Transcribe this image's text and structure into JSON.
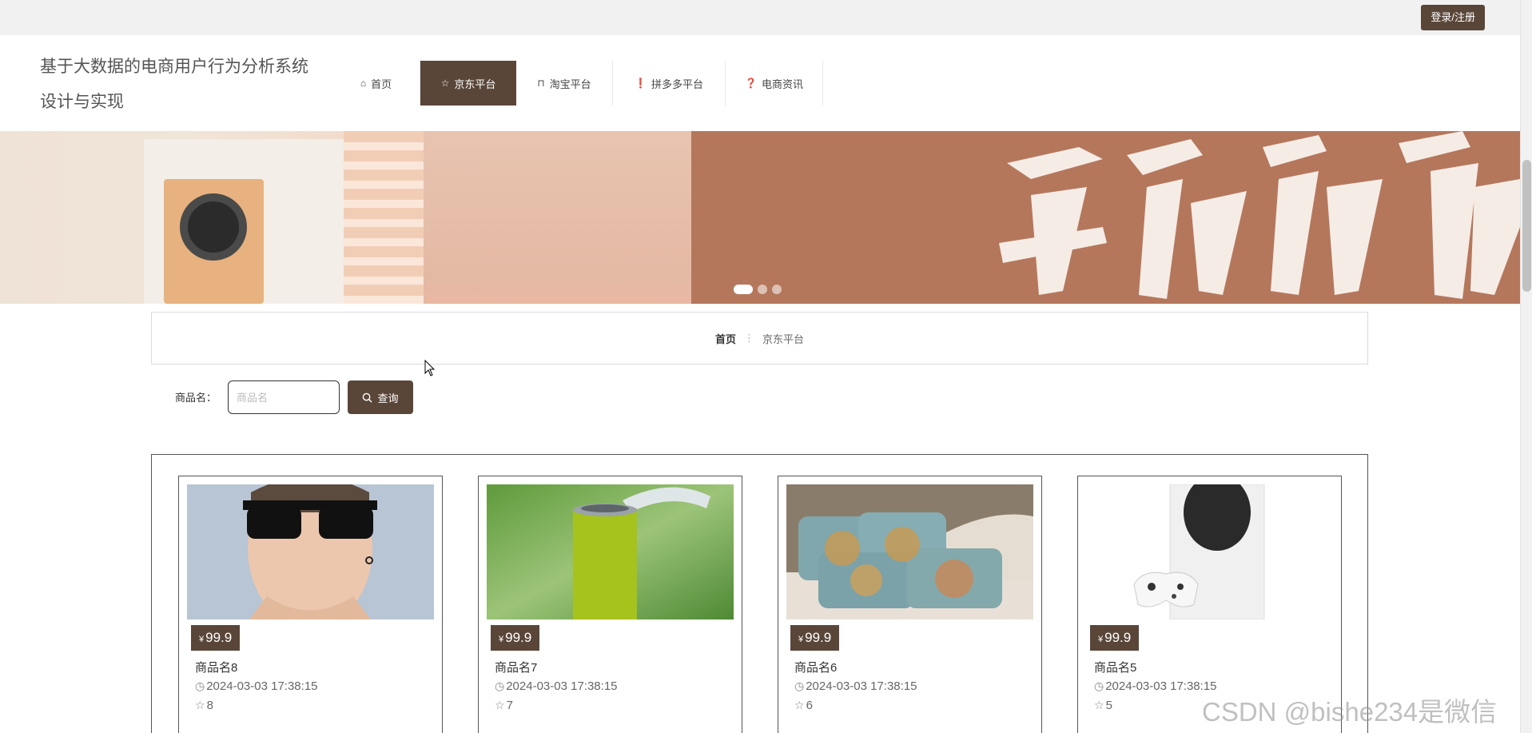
{
  "topbar": {
    "login_label": "登录/注册"
  },
  "header": {
    "title": "基于大数据的电商用户行为分析系统设计与实现",
    "nav": [
      {
        "label": "首页",
        "icon": "home-icon",
        "active": false
      },
      {
        "label": "京东平台",
        "icon": "star-icon",
        "active": true
      },
      {
        "label": "淘宝平台",
        "icon": "bag-icon",
        "active": false
      },
      {
        "label": "拼多多平台",
        "icon": "alert-icon",
        "active": false
      },
      {
        "label": "电商资讯",
        "icon": "question-icon",
        "active": false
      }
    ]
  },
  "banner": {
    "slides": 3,
    "active_slide": 1
  },
  "breadcrumb": {
    "home": "首页",
    "separator": "⋮",
    "current": "京东平台"
  },
  "search": {
    "label": "商品名：",
    "placeholder": "商品名",
    "value": "",
    "button_label": "查询"
  },
  "products": [
    {
      "price_symbol": "¥",
      "price": "99.9",
      "name": "商品名8",
      "time": "2024-03-03 17:38:15",
      "favorites": "8",
      "image": "sunglasses-man"
    },
    {
      "price_symbol": "¥",
      "price": "99.9",
      "name": "商品名7",
      "time": "2024-03-03 17:38:15",
      "favorites": "7",
      "image": "green-filter"
    },
    {
      "price_symbol": "¥",
      "price": "99.9",
      "name": "商品名6",
      "time": "2024-03-03 17:38:15",
      "favorites": "6",
      "image": "pillows"
    },
    {
      "price_symbol": "¥",
      "price": "99.9",
      "name": "商品名5",
      "time": "2024-03-03 17:38:15",
      "favorites": "5",
      "image": "game-console"
    }
  ],
  "watermark": "CSDN @bishe234是微信",
  "colors": {
    "accent": "#5a4639",
    "topbar": "#f1f1f1",
    "banner": "#b5775c"
  }
}
